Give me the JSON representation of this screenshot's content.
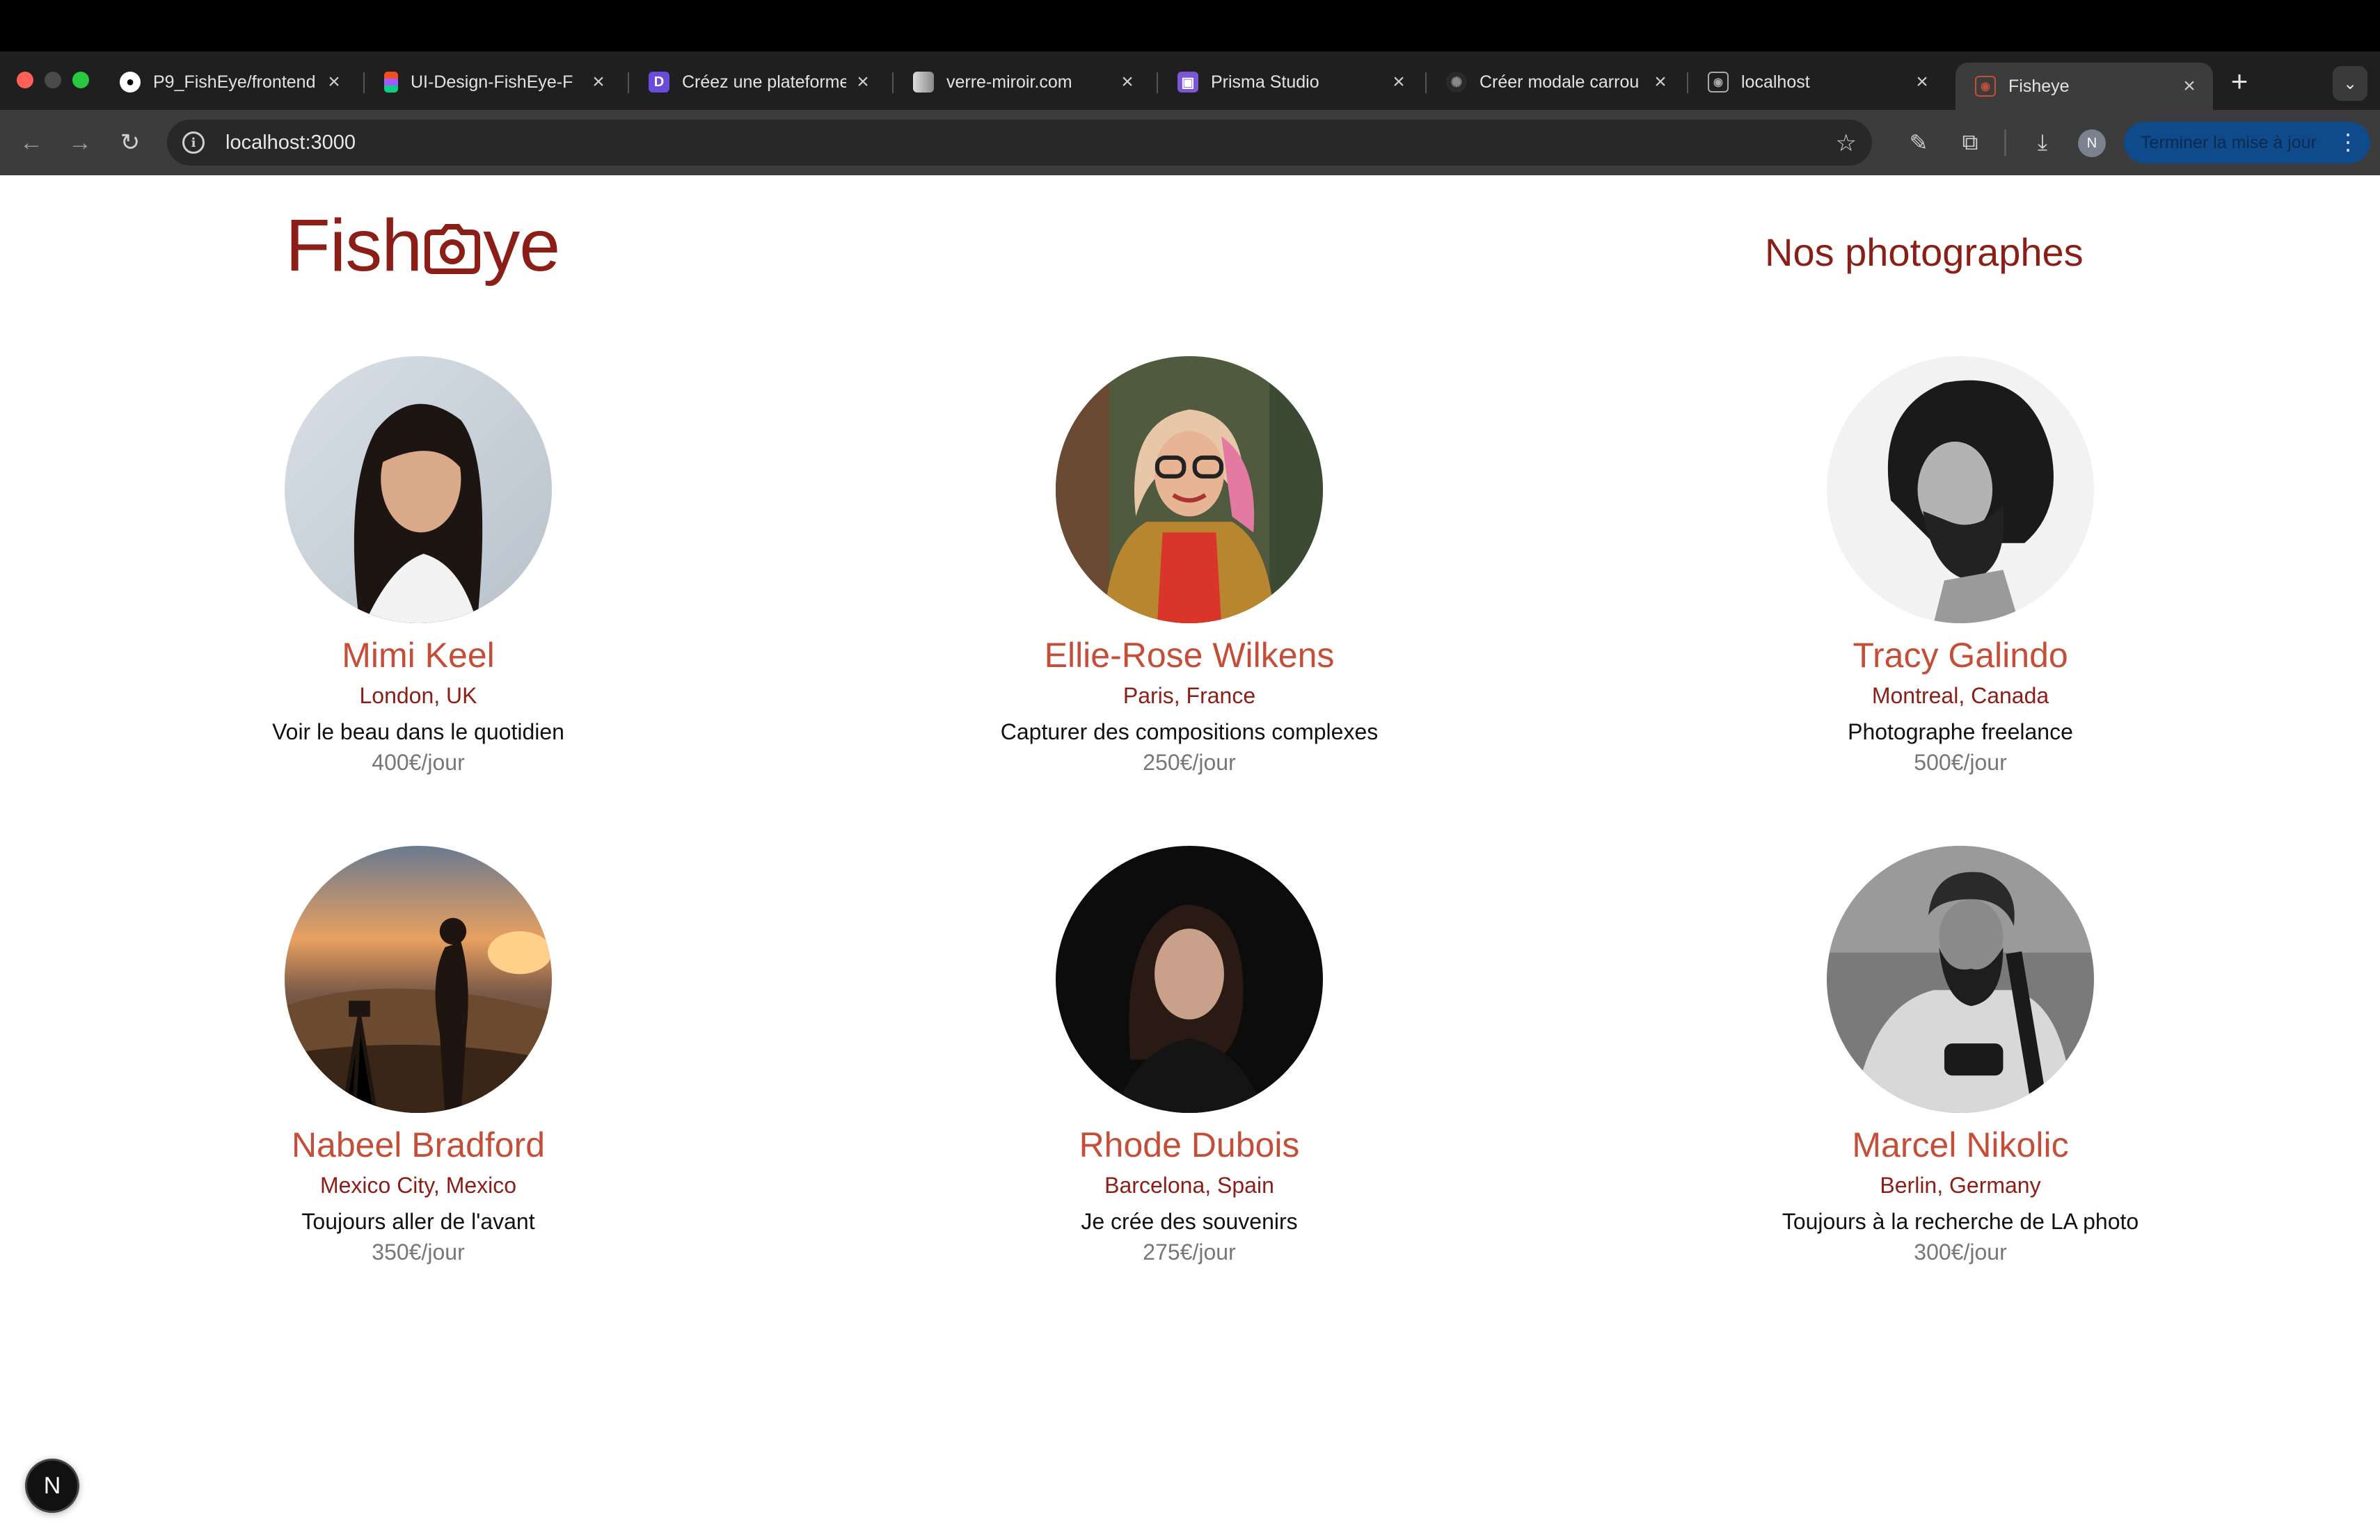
{
  "browser": {
    "tabs": [
      {
        "title": "P9_FishEye/frontend",
        "icon": "github-icon"
      },
      {
        "title": "UI-Design-FishEye-F",
        "icon": "figma-icon"
      },
      {
        "title": "Créez une plateforme",
        "icon": "openclassrooms-icon"
      },
      {
        "title": "verre-miroir.com",
        "icon": "site-icon"
      },
      {
        "title": "Prisma Studio",
        "icon": "prisma-icon"
      },
      {
        "title": "Créer modale carrou",
        "icon": "chatgpt-icon"
      },
      {
        "title": "localhost",
        "icon": "camera-icon"
      },
      {
        "title": "Fisheye",
        "icon": "camera-icon",
        "active": true
      }
    ],
    "address": "localhost:3000",
    "update_button": "Terminer la mise à jour",
    "profile_initial": "N"
  },
  "header": {
    "logo_left": "Fish",
    "logo_right": "ye",
    "title": "Nos photographes"
  },
  "photographers": [
    {
      "name": "Mimi Keel",
      "location": "London, UK",
      "tagline": "Voir le beau dans le quotidien",
      "price": "400€/jour"
    },
    {
      "name": "Ellie-Rose Wilkens",
      "location": "Paris, France",
      "tagline": "Capturer des compositions complexes",
      "price": "250€/jour"
    },
    {
      "name": "Tracy Galindo",
      "location": "Montreal, Canada",
      "tagline": "Photographe freelance",
      "price": "500€/jour"
    },
    {
      "name": "Nabeel Bradford",
      "location": "Mexico City, Mexico",
      "tagline": "Toujours aller de l'avant",
      "price": "350€/jour"
    },
    {
      "name": "Rhode Dubois",
      "location": "Barcelona, Spain",
      "tagline": "Je crée des souvenirs",
      "price": "275€/jour"
    },
    {
      "name": "Marcel Nikolic",
      "location": "Berlin, Germany",
      "tagline": "Toujours à la recherche de LA photo",
      "price": "300€/jour"
    }
  ],
  "dev_badge": "N",
  "colors": {
    "brand": "#8b1e17",
    "name": "#c44e38",
    "price": "#777777"
  }
}
